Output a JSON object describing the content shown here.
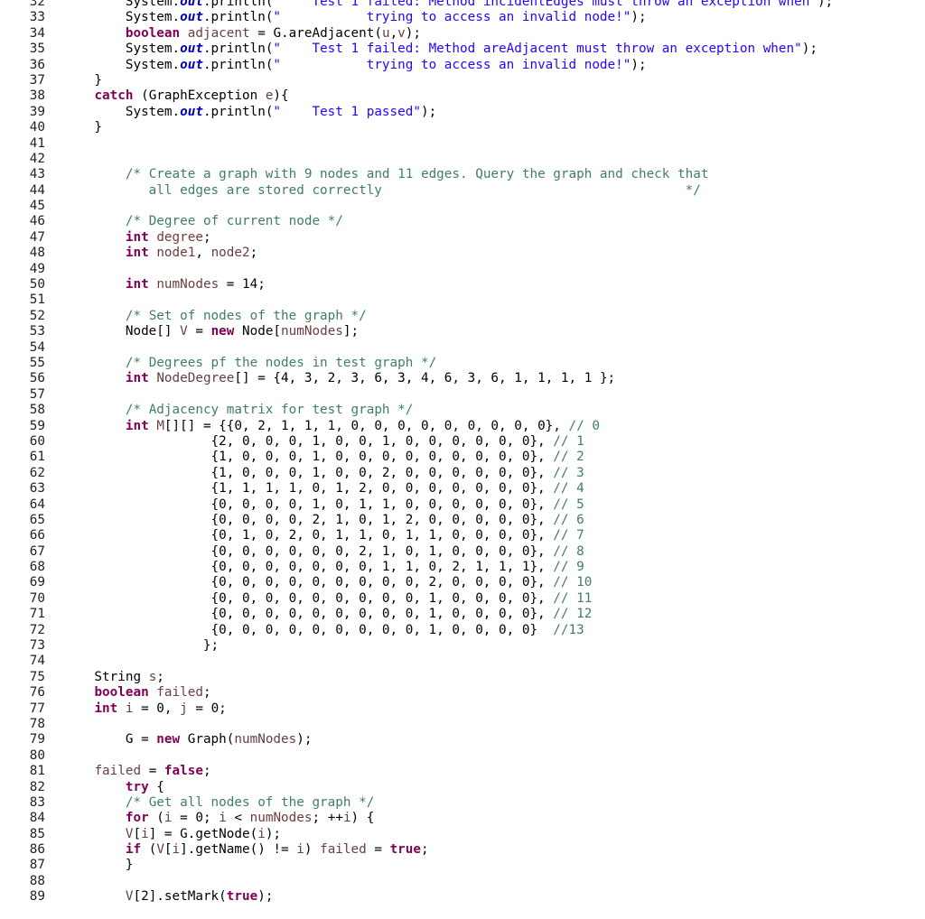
{
  "colors": {
    "keyword": "#7f0055",
    "string": "#2a00ff",
    "comment": "#3f7f5f",
    "field": "#0000c0",
    "variable": "#6a3e3e",
    "plain": "#000000",
    "line_number": "#222222",
    "background": "#ffffff"
  },
  "lines": [
    {
      "n": "32",
      "t": [
        [
          "pl",
          "        System."
        ],
        [
          "fld",
          "out"
        ],
        [
          "pl",
          ".println("
        ],
        [
          "str",
          "\"    Test 1 failed: Method incidentEdges must throw an exception when\""
        ],
        [
          "pl",
          ");"
        ]
      ]
    },
    {
      "n": "33",
      "t": [
        [
          "pl",
          "        System."
        ],
        [
          "fld",
          "out"
        ],
        [
          "pl",
          ".println("
        ],
        [
          "str",
          "\"           trying to access an invalid node!\""
        ],
        [
          "pl",
          ");"
        ]
      ]
    },
    {
      "n": "34",
      "t": [
        [
          "pl",
          "        "
        ],
        [
          "kw",
          "boolean"
        ],
        [
          "pl",
          " "
        ],
        [
          "var",
          "adjacent"
        ],
        [
          "pl",
          " = G.areAdjacent("
        ],
        [
          "var",
          "u"
        ],
        [
          "pl",
          ","
        ],
        [
          "var",
          "v"
        ],
        [
          "pl",
          ");"
        ]
      ]
    },
    {
      "n": "35",
      "t": [
        [
          "pl",
          "        System."
        ],
        [
          "fld",
          "out"
        ],
        [
          "pl",
          ".println("
        ],
        [
          "str",
          "\"    Test 1 failed: Method areAdjacent must throw an exception when\""
        ],
        [
          "pl",
          ");"
        ]
      ]
    },
    {
      "n": "36",
      "t": [
        [
          "pl",
          "        System."
        ],
        [
          "fld",
          "out"
        ],
        [
          "pl",
          ".println("
        ],
        [
          "str",
          "\"           trying to access an invalid node!\""
        ],
        [
          "pl",
          ");"
        ]
      ]
    },
    {
      "n": "37",
      "t": [
        [
          "pl",
          "    }"
        ]
      ]
    },
    {
      "n": "38",
      "t": [
        [
          "pl",
          "    "
        ],
        [
          "kw",
          "catch"
        ],
        [
          "pl",
          " (GraphException "
        ],
        [
          "var",
          "e"
        ],
        [
          "pl",
          "){"
        ]
      ]
    },
    {
      "n": "39",
      "t": [
        [
          "pl",
          "        System."
        ],
        [
          "fld",
          "out"
        ],
        [
          "pl",
          ".println("
        ],
        [
          "str",
          "\"    Test 1 passed\""
        ],
        [
          "pl",
          ");"
        ]
      ]
    },
    {
      "n": "40",
      "t": [
        [
          "pl",
          "    }"
        ]
      ]
    },
    {
      "n": "41",
      "t": []
    },
    {
      "n": "42",
      "t": []
    },
    {
      "n": "43",
      "t": [
        [
          "pl",
          "        "
        ],
        [
          "cm",
          "/* Create a graph with 9 nodes and 11 edges. Query the graph and check that"
        ]
      ]
    },
    {
      "n": "44",
      "t": [
        [
          "cm",
          "           all edges are stored correctly                                       */"
        ]
      ]
    },
    {
      "n": "45",
      "t": []
    },
    {
      "n": "46",
      "t": [
        [
          "pl",
          "        "
        ],
        [
          "cm",
          "/* Degree of current node */"
        ]
      ]
    },
    {
      "n": "47",
      "t": [
        [
          "pl",
          "        "
        ],
        [
          "kw",
          "int"
        ],
        [
          "pl",
          " "
        ],
        [
          "var",
          "degree"
        ],
        [
          "pl",
          ";"
        ]
      ]
    },
    {
      "n": "48",
      "t": [
        [
          "pl",
          "        "
        ],
        [
          "kw",
          "int"
        ],
        [
          "pl",
          " "
        ],
        [
          "var",
          "node1"
        ],
        [
          "pl",
          ", "
        ],
        [
          "var",
          "node2"
        ],
        [
          "pl",
          ";"
        ]
      ]
    },
    {
      "n": "49",
      "t": []
    },
    {
      "n": "50",
      "t": [
        [
          "pl",
          "        "
        ],
        [
          "kw",
          "int"
        ],
        [
          "pl",
          " "
        ],
        [
          "var",
          "numNodes"
        ],
        [
          "pl",
          " = 14;"
        ]
      ]
    },
    {
      "n": "51",
      "t": []
    },
    {
      "n": "52",
      "t": [
        [
          "pl",
          "        "
        ],
        [
          "cm",
          "/* Set of nodes of the graph */"
        ]
      ]
    },
    {
      "n": "53",
      "t": [
        [
          "pl",
          "        Node[] "
        ],
        [
          "var",
          "V"
        ],
        [
          "pl",
          " = "
        ],
        [
          "kw",
          "new"
        ],
        [
          "pl",
          " Node["
        ],
        [
          "var",
          "numNodes"
        ],
        [
          "pl",
          "];"
        ]
      ]
    },
    {
      "n": "54",
      "t": []
    },
    {
      "n": "55",
      "t": [
        [
          "pl",
          "        "
        ],
        [
          "cm",
          "/* Degrees pf the nodes in test graph */"
        ]
      ]
    },
    {
      "n": "56",
      "t": [
        [
          "pl",
          "        "
        ],
        [
          "kw",
          "int"
        ],
        [
          "pl",
          " "
        ],
        [
          "var",
          "NodeDegree"
        ],
        [
          "pl",
          "[] = {4, 3, 2, 3, 6, 3, 4, 6, 3, 6, 1, 1, 1, 1 };"
        ]
      ]
    },
    {
      "n": "57",
      "t": []
    },
    {
      "n": "58",
      "t": [
        [
          "pl",
          "        "
        ],
        [
          "cm",
          "/* Adjacency matrix for test graph */"
        ]
      ]
    },
    {
      "n": "59",
      "t": [
        [
          "pl",
          "        "
        ],
        [
          "kw",
          "int"
        ],
        [
          "pl",
          " "
        ],
        [
          "var",
          "M"
        ],
        [
          "pl",
          "[][] = {{0, 2, 1, 1, 1, 0, 0, 0, 0, 0, 0, 0, 0, 0}, "
        ],
        [
          "cm",
          "// 0"
        ]
      ]
    },
    {
      "n": "60",
      "t": [
        [
          "pl",
          "                   {2, 0, 0, 0, 1, 0, 0, 1, 0, 0, 0, 0, 0, 0}, "
        ],
        [
          "cm",
          "// 1"
        ]
      ]
    },
    {
      "n": "61",
      "t": [
        [
          "pl",
          "                   {1, 0, 0, 0, 1, 0, 0, 0, 0, 0, 0, 0, 0, 0}, "
        ],
        [
          "cm",
          "// 2"
        ]
      ]
    },
    {
      "n": "62",
      "t": [
        [
          "pl",
          "                   {1, 0, 0, 0, 1, 0, 0, 2, 0, 0, 0, 0, 0, 0}, "
        ],
        [
          "cm",
          "// 3"
        ]
      ]
    },
    {
      "n": "63",
      "t": [
        [
          "pl",
          "                   {1, 1, 1, 1, 0, 1, 2, 0, 0, 0, 0, 0, 0, 0}, "
        ],
        [
          "cm",
          "// 4"
        ]
      ]
    },
    {
      "n": "64",
      "t": [
        [
          "pl",
          "                   {0, 0, 0, 0, 1, 0, 1, 1, 0, 0, 0, 0, 0, 0}, "
        ],
        [
          "cm",
          "// 5"
        ]
      ]
    },
    {
      "n": "65",
      "t": [
        [
          "pl",
          "                   {0, 0, 0, 0, 2, 1, 0, 1, 2, 0, 0, 0, 0, 0}, "
        ],
        [
          "cm",
          "// 6"
        ]
      ]
    },
    {
      "n": "66",
      "t": [
        [
          "pl",
          "                   {0, 1, 0, 2, 0, 1, 1, 0, 1, 1, 0, 0, 0, 0}, "
        ],
        [
          "cm",
          "// 7"
        ]
      ]
    },
    {
      "n": "67",
      "t": [
        [
          "pl",
          "                   {0, 0, 0, 0, 0, 0, 2, 1, 0, 1, 0, 0, 0, 0}, "
        ],
        [
          "cm",
          "// 8"
        ]
      ]
    },
    {
      "n": "68",
      "t": [
        [
          "pl",
          "                   {0, 0, 0, 0, 0, 0, 0, 1, 1, 0, 2, 1, 1, 1}, "
        ],
        [
          "cm",
          "// 9"
        ]
      ]
    },
    {
      "n": "69",
      "t": [
        [
          "pl",
          "                   {0, 0, 0, 0, 0, 0, 0, 0, 0, 2, 0, 0, 0, 0}, "
        ],
        [
          "cm",
          "// 10"
        ]
      ]
    },
    {
      "n": "70",
      "t": [
        [
          "pl",
          "                   {0, 0, 0, 0, 0, 0, 0, 0, 0, 1, 0, 0, 0, 0}, "
        ],
        [
          "cm",
          "// 11"
        ]
      ]
    },
    {
      "n": "71",
      "t": [
        [
          "pl",
          "                   {0, 0, 0, 0, 0, 0, 0, 0, 0, 1, 0, 0, 0, 0}, "
        ],
        [
          "cm",
          "// 12"
        ]
      ]
    },
    {
      "n": "72",
      "t": [
        [
          "pl",
          "                   {0, 0, 0, 0, 0, 0, 0, 0, 0, 1, 0, 0, 0, 0}  "
        ],
        [
          "cm",
          "//13"
        ]
      ]
    },
    {
      "n": "73",
      "t": [
        [
          "pl",
          "                  };"
        ]
      ]
    },
    {
      "n": "74",
      "t": []
    },
    {
      "n": "75",
      "t": [
        [
          "pl",
          "    String "
        ],
        [
          "var",
          "s"
        ],
        [
          "pl",
          ";"
        ]
      ]
    },
    {
      "n": "76",
      "t": [
        [
          "pl",
          "    "
        ],
        [
          "kw",
          "boolean"
        ],
        [
          "pl",
          " "
        ],
        [
          "var",
          "failed"
        ],
        [
          "pl",
          ";"
        ]
      ]
    },
    {
      "n": "77",
      "t": [
        [
          "pl",
          "    "
        ],
        [
          "kw",
          "int"
        ],
        [
          "pl",
          " "
        ],
        [
          "var",
          "i"
        ],
        [
          "pl",
          " = 0, "
        ],
        [
          "var",
          "j"
        ],
        [
          "pl",
          " = 0;"
        ]
      ]
    },
    {
      "n": "78",
      "t": []
    },
    {
      "n": "79",
      "t": [
        [
          "pl",
          "        G = "
        ],
        [
          "kw",
          "new"
        ],
        [
          "pl",
          " Graph("
        ],
        [
          "var",
          "numNodes"
        ],
        [
          "pl",
          ");"
        ]
      ]
    },
    {
      "n": "80",
      "t": []
    },
    {
      "n": "81",
      "t": [
        [
          "pl",
          "    "
        ],
        [
          "var",
          "failed"
        ],
        [
          "pl",
          " = "
        ],
        [
          "kw",
          "false"
        ],
        [
          "pl",
          ";"
        ]
      ]
    },
    {
      "n": "82",
      "t": [
        [
          "pl",
          "        "
        ],
        [
          "kw",
          "try"
        ],
        [
          "pl",
          " {"
        ]
      ]
    },
    {
      "n": "83",
      "t": [
        [
          "pl",
          "        "
        ],
        [
          "cm",
          "/* Get all nodes of the graph */"
        ]
      ]
    },
    {
      "n": "84",
      "t": [
        [
          "pl",
          "        "
        ],
        [
          "kw",
          "for"
        ],
        [
          "pl",
          " ("
        ],
        [
          "var",
          "i"
        ],
        [
          "pl",
          " = 0; "
        ],
        [
          "var",
          "i"
        ],
        [
          "pl",
          " < "
        ],
        [
          "var",
          "numNodes"
        ],
        [
          "pl",
          "; ++"
        ],
        [
          "var",
          "i"
        ],
        [
          "pl",
          ") {"
        ]
      ]
    },
    {
      "n": "85",
      "t": [
        [
          "pl",
          "        "
        ],
        [
          "var",
          "V"
        ],
        [
          "pl",
          "["
        ],
        [
          "var",
          "i"
        ],
        [
          "pl",
          "] = G.getNode("
        ],
        [
          "var",
          "i"
        ],
        [
          "pl",
          ");"
        ]
      ]
    },
    {
      "n": "86",
      "t": [
        [
          "pl",
          "        "
        ],
        [
          "kw",
          "if"
        ],
        [
          "pl",
          " ("
        ],
        [
          "var",
          "V"
        ],
        [
          "pl",
          "["
        ],
        [
          "var",
          "i"
        ],
        [
          "pl",
          "].getName() != "
        ],
        [
          "var",
          "i"
        ],
        [
          "pl",
          ") "
        ],
        [
          "var",
          "failed"
        ],
        [
          "pl",
          " = "
        ],
        [
          "kw",
          "true"
        ],
        [
          "pl",
          ";"
        ]
      ]
    },
    {
      "n": "87",
      "t": [
        [
          "pl",
          "        }"
        ]
      ]
    },
    {
      "n": "88",
      "t": []
    },
    {
      "n": "89",
      "t": [
        [
          "pl",
          "        "
        ],
        [
          "var",
          "V"
        ],
        [
          "pl",
          "[2].setMark("
        ],
        [
          "kw",
          "true"
        ],
        [
          "pl",
          ");"
        ]
      ]
    }
  ]
}
